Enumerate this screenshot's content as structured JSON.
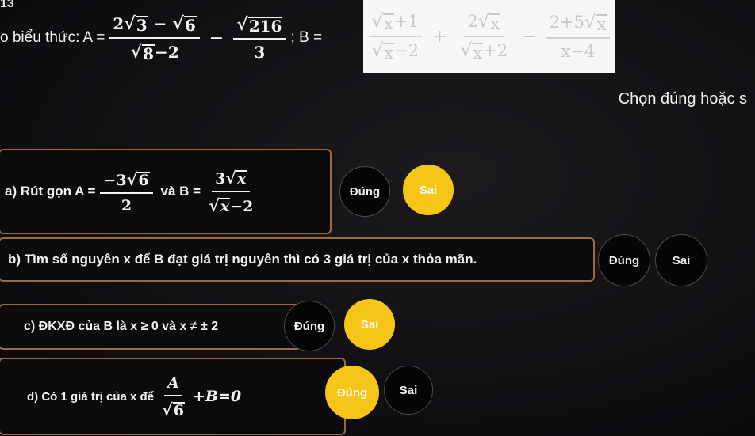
{
  "question": {
    "number": "13",
    "prompt_label": "o biểu thức:",
    "a_label": "A =",
    "a_term1_num_a": "2",
    "a_term1_num_rad1": "3",
    "a_term1_num_minus": "−",
    "a_term1_num_rad2": "6",
    "a_term1_den_rad": "8",
    "a_term1_den_rest": "−2",
    "a_minus": "−",
    "a_term2_num_rad": "216",
    "a_term2_den": "3",
    "separator": "; B =",
    "b_term1_num_rad": "x",
    "b_term1_num_rest": "+1",
    "b_term1_den_rad": "x",
    "b_term1_den_rest": "−2",
    "b_plus": "+",
    "b_term2_num_a": "2",
    "b_term2_num_rad": "x",
    "b_term2_den_rad": "x",
    "b_term2_den_rest": "+2",
    "b_minus": "−",
    "b_term3_num_a": "2+5",
    "b_term3_num_rad": "x",
    "b_term3_den": "x−4"
  },
  "instruction": "Chọn đúng hoặc s",
  "options": {
    "a": {
      "text1": "a) Rút gọn A =",
      "frac1_num_a": "−3",
      "frac1_num_rad": "6",
      "frac1_den": "2",
      "text2": "và B =",
      "frac2_num_a": "3",
      "frac2_num_rad": "x",
      "frac2_den_rad": "x",
      "frac2_den_rest": "−2",
      "dung": "Đúng",
      "sai": "Sai"
    },
    "b": {
      "text": "b) Tìm số nguyên x để B đạt giá trị nguyên thì có 3 giá trị của x thỏa mãn.",
      "dung": "Đúng",
      "sai": "Sai"
    },
    "c": {
      "text": "c) ĐKXĐ của B là x ≥ 0 và x ≠ ± 2",
      "dung": "Đúng",
      "sai": "Sai"
    },
    "d": {
      "text1": "d) Có 1 giá trị của x để",
      "frac_num": "A",
      "frac_den_rad": "6",
      "text2": "+B=0",
      "dung": "Đúng",
      "sai": "Sai"
    }
  },
  "colors": {
    "selected": "#f5c518",
    "card_border": "#9b6b3f",
    "unselected_bg": "#050505"
  }
}
